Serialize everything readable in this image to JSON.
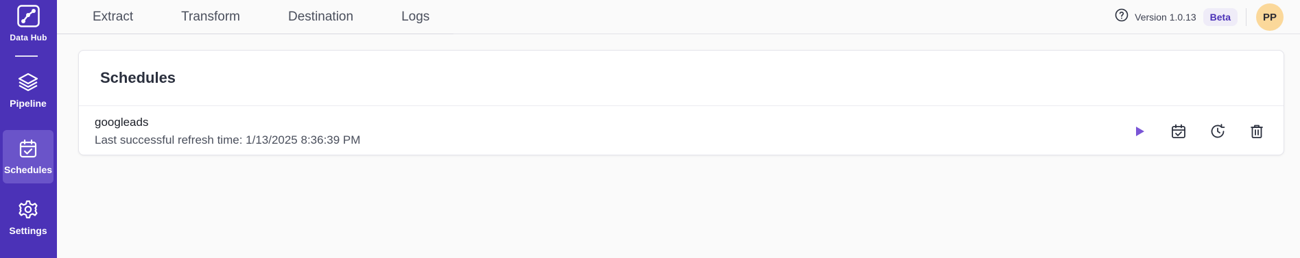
{
  "app": {
    "brand_label": "Data Hub",
    "accent": "#4b32b7"
  },
  "sidebar": {
    "items": [
      {
        "label": "Pipeline",
        "icon": "layers-icon",
        "active": false
      },
      {
        "label": "Schedules",
        "icon": "calendar-check-icon",
        "active": true
      },
      {
        "label": "Settings",
        "icon": "gear-icon",
        "active": false
      }
    ]
  },
  "topbar": {
    "tabs": [
      "Extract",
      "Transform",
      "Destination",
      "Logs"
    ],
    "version": "Version 1.0.13",
    "badge": "Beta",
    "avatar_initials": "PP"
  },
  "schedules": {
    "title": "Schedules",
    "rows": [
      {
        "name": "googleads",
        "status": "Last successful refresh time: 1/13/2025 8:36:39 PM",
        "actions": [
          "play-icon",
          "calendar-check-icon",
          "history-icon",
          "trash-icon"
        ]
      }
    ]
  }
}
